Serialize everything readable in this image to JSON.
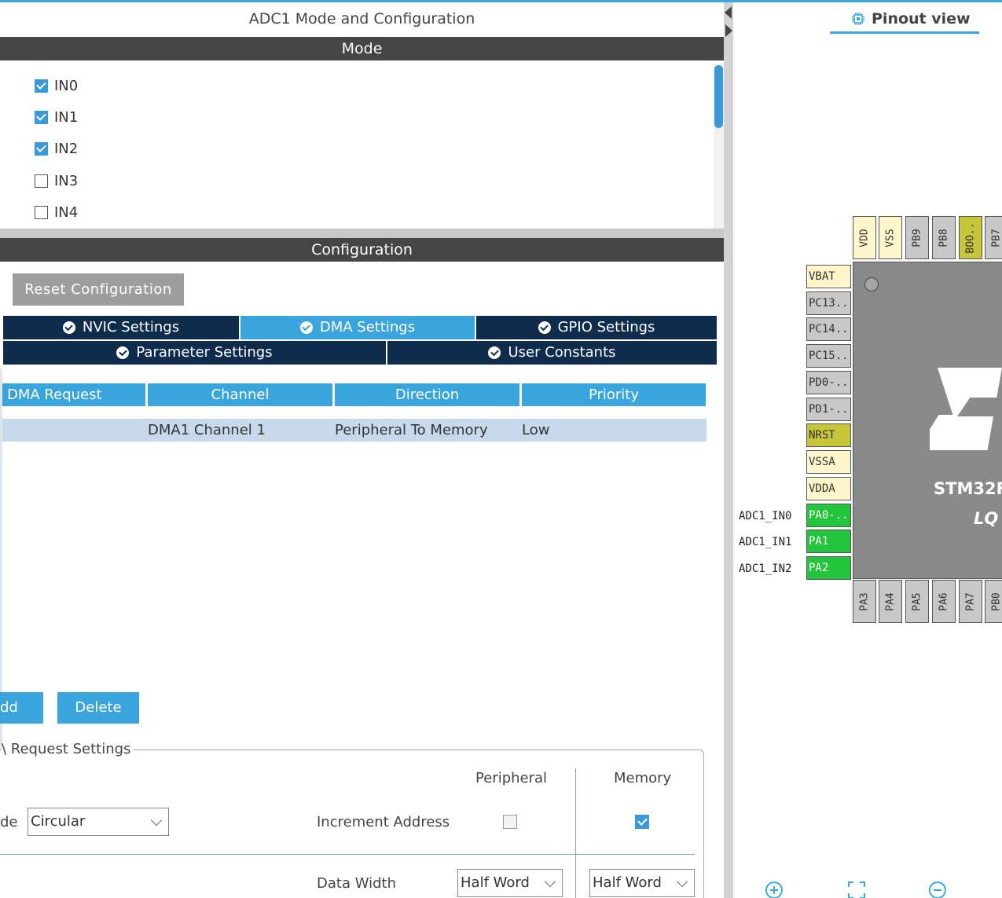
{
  "left": {
    "title": "ADC1 Mode and Configuration",
    "mode_header": "Mode",
    "mode_items": [
      {
        "label": "IN0",
        "checked": true
      },
      {
        "label": "IN1",
        "checked": true
      },
      {
        "label": "IN2",
        "checked": true
      },
      {
        "label": "IN3",
        "checked": false
      },
      {
        "label": "IN4",
        "checked": false
      }
    ],
    "config_header": "Configuration",
    "reset_label": "Reset Configuration",
    "tabs_row1": [
      "NVIC Settings",
      "DMA Settings",
      "GPIO Settings"
    ],
    "tabs_row2": [
      "Parameter Settings",
      "User Constants"
    ],
    "active_tab": "DMA Settings",
    "table": {
      "headers": [
        "DMA Request",
        "Channel",
        "Direction",
        "Priority"
      ],
      "rows": [
        [
          "",
          "DMA1 Channel 1",
          "Peripheral To Memory",
          "Low"
        ]
      ]
    },
    "add_label": "dd",
    "delete_label": "Delete",
    "settings_legend": "\\ Request Settings",
    "col_peripheral": "Peripheral",
    "col_memory": "Memory",
    "mode_label": "de",
    "mode_value": "Circular",
    "increment_label": "Increment Address",
    "increment_peripheral": false,
    "increment_memory": true,
    "data_width_label": "Data Width",
    "data_width_peripheral": "Half Word",
    "data_width_memory": "Half Word"
  },
  "right": {
    "title": "Pinout view",
    "chip_name": "STM32F",
    "chip_pkg": "LQ",
    "top_pins": [
      {
        "name": "VDD",
        "color": "yellow"
      },
      {
        "name": "VSS",
        "color": "yellow"
      },
      {
        "name": "PB9",
        "color": "gray"
      },
      {
        "name": "PB8",
        "color": "gray"
      },
      {
        "name": "BOO..",
        "color": "olive"
      },
      {
        "name": "PB7",
        "color": "gray"
      }
    ],
    "left_pins": [
      {
        "name": "VBAT",
        "color": "yellow",
        "signal": ""
      },
      {
        "name": "PC13..",
        "color": "gray",
        "signal": ""
      },
      {
        "name": "PC14..",
        "color": "gray",
        "signal": ""
      },
      {
        "name": "PC15..",
        "color": "gray",
        "signal": ""
      },
      {
        "name": "PD0-..",
        "color": "gray",
        "signal": ""
      },
      {
        "name": "PD1-..",
        "color": "gray",
        "signal": ""
      },
      {
        "name": "NRST",
        "color": "olive",
        "signal": ""
      },
      {
        "name": "VSSA",
        "color": "yellow",
        "signal": ""
      },
      {
        "name": "VDDA",
        "color": "yellow",
        "signal": ""
      },
      {
        "name": "PA0-..",
        "color": "green",
        "signal": "ADC1_IN0"
      },
      {
        "name": "PA1",
        "color": "green",
        "signal": "ADC1_IN1"
      },
      {
        "name": "PA2",
        "color": "green",
        "signal": "ADC1_IN2"
      }
    ],
    "bottom_pins": [
      {
        "name": "PA3",
        "color": "gray"
      },
      {
        "name": "PA4",
        "color": "gray"
      },
      {
        "name": "PA5",
        "color": "gray"
      },
      {
        "name": "PA6",
        "color": "gray"
      },
      {
        "name": "PA7",
        "color": "gray"
      },
      {
        "name": "PB0",
        "color": "gray"
      }
    ]
  },
  "colors": {
    "accent": "#3aa5dc",
    "tab_dark": "#0f2c4d",
    "bar_dark": "#454545",
    "pin_green": "#22c53b",
    "pin_yellow": "#fff6cc",
    "pin_olive": "#c6c63a",
    "pin_gray": "#c8c8c8"
  }
}
